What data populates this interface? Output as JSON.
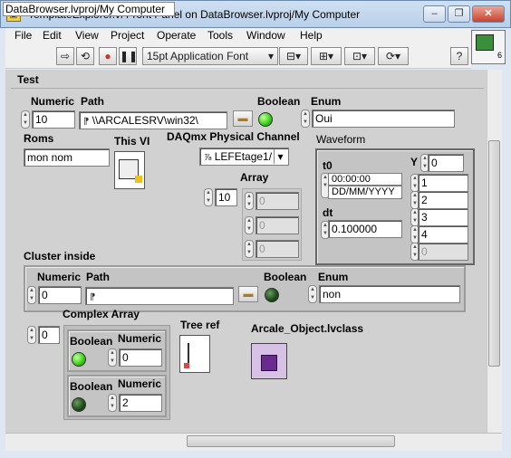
{
  "window": {
    "title": "TemplateExplorer.vi Front Panel on DataBrowser.lvproj/My Computer",
    "minimize": "–",
    "restore": "❐",
    "close": "✕"
  },
  "menubar": [
    "File",
    "Edit",
    "View",
    "Project",
    "Operate",
    "Tools",
    "Window",
    "Help"
  ],
  "toolbar": {
    "font_select": "15pt Application Font",
    "help": "?",
    "connector_number": "6"
  },
  "panel": {
    "page_label": "Test",
    "numeric_label": "Numeric",
    "numeric_value": "10",
    "path_label": "Path",
    "path_value": "\\\\ARCALESRV\\win32\\",
    "boolean_label": "Boolean",
    "enum_label": "Enum",
    "enum_value": "Oui",
    "roms_label": "Roms",
    "roms_value": "mon nom",
    "thisvi_label": "This VI",
    "daqmx_label": "DAQmx Physical Channel",
    "daqmx_value": "LEFEtage1/",
    "array_label": "Array",
    "array_index": "10",
    "array_values": [
      "0",
      "0",
      "0"
    ],
    "waveform": {
      "label": "Waveform",
      "t0_label": "t0",
      "t0_time": "00:00:00",
      "t0_date": "DD/MM/YYYY",
      "dt_label": "dt",
      "dt_value": "0.100000",
      "y_label": "Y",
      "y_index": "0",
      "y_values": [
        "1",
        "2",
        "3",
        "4",
        "0"
      ]
    },
    "cluster_inside": {
      "label": "Cluster inside",
      "numeric_label": "Numeric",
      "numeric_value": "0",
      "path_label": "Path",
      "path_value": "",
      "boolean_label": "Boolean",
      "enum_label": "Enum",
      "enum_value": "non"
    },
    "complex_array": {
      "label": "Complex Array",
      "index": "0",
      "items": [
        {
          "boolean_label": "Boolean",
          "numeric_label": "Numeric",
          "numeric_value": "0",
          "led": "on"
        },
        {
          "boolean_label": "Boolean",
          "numeric_label": "Numeric",
          "numeric_value": "2",
          "led": "off"
        }
      ]
    },
    "tree_ref_label": "Tree ref",
    "class_label": "Arcale_Object.lvclass"
  },
  "status": {
    "context": "DataBrowser.lvproj/My Computer"
  }
}
